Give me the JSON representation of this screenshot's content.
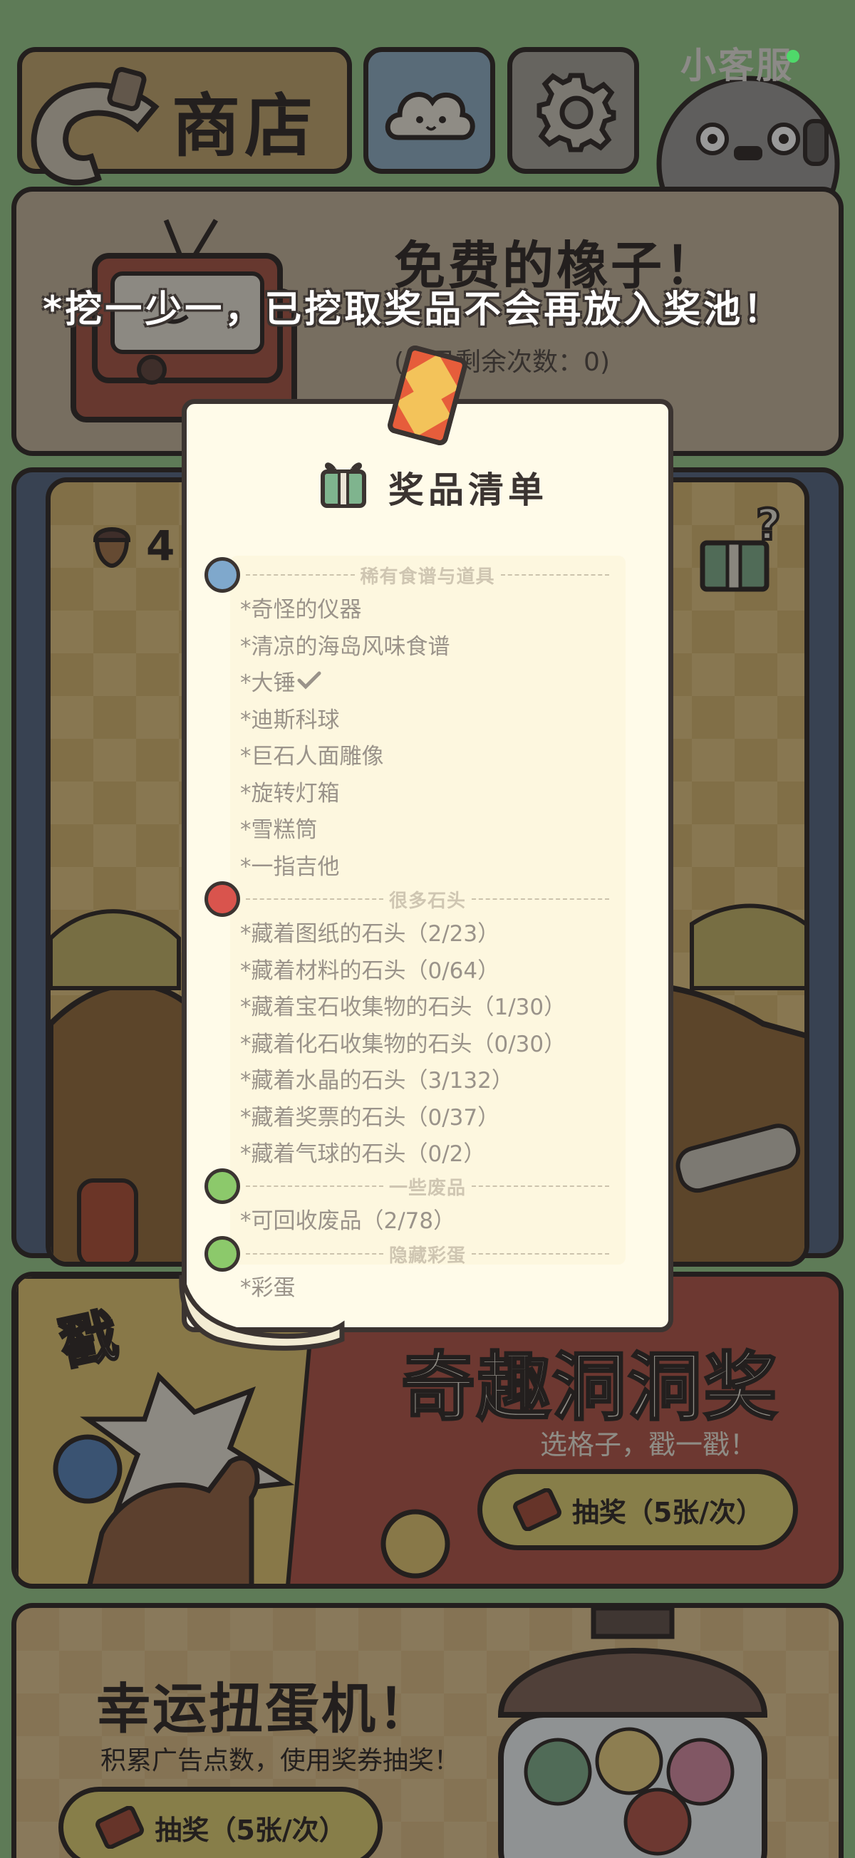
{
  "header": {
    "shop_label": "商店",
    "customer_service_label": "小客服",
    "online_dot_color": "#4fd96a"
  },
  "banner_message": "*挖一少一，已挖取奖品不会再放入奖池！",
  "free_acorn": {
    "title": "免费的橡子！",
    "remaining_label": "(今日剩余次数：0)"
  },
  "dig": {
    "acorn_count": "4"
  },
  "modal": {
    "title": "奖品清单",
    "sections": [
      {
        "title": "稀有食谱与道具",
        "dot_color": "#7fa8cc",
        "items": [
          "*奇怪的仪器",
          "*清凉的海岛风味食谱",
          "*大锤",
          "*迪斯科球",
          "*巨石人面雕像",
          "*旋转灯箱",
          "*雪糕筒",
          "*一指吉他"
        ]
      },
      {
        "title": "很多石头",
        "dot_color": "#d9544d",
        "items": [
          "*藏着图纸的石头（2/23）",
          "*藏着材料的石头（0/64）",
          "*藏着宝石收集物的石头（1/30）",
          "*藏着化石收集物的石头（0/30）",
          "*藏着水晶的石头（3/132）",
          "*藏着奖票的石头（0/37）",
          "*藏着气球的石头（0/2）"
        ]
      },
      {
        "title": "一些废品",
        "dot_color": "#8cc96b",
        "items": [
          "*可回收废品（2/78）"
        ]
      },
      {
        "title": "隐藏彩蛋",
        "dot_color": "#8cc96b",
        "items": [
          "*彩蛋"
        ]
      }
    ],
    "checked_item": "*大锤"
  },
  "poke": {
    "stamp_text": "戳",
    "title": "奇趣洞洞奖",
    "subtitle": "选格子，戳一戳！",
    "draw_button": "抽奖（5张/次）"
  },
  "gacha": {
    "title": "幸运扭蛋机！",
    "subtitle": "积累广告点数，使用奖券抽奖！",
    "draw_button": "抽奖（5张/次）"
  }
}
